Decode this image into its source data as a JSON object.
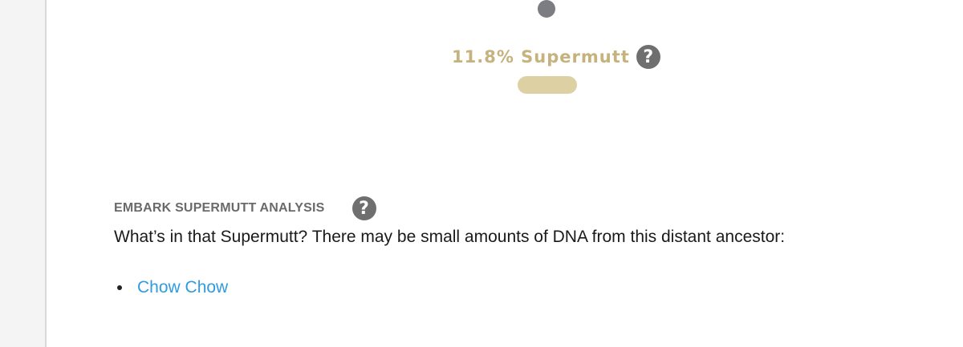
{
  "supermutt": {
    "label": "11.8% Supermutt",
    "help_icon": "question-circle-icon"
  },
  "analysis": {
    "title": "EMBARK SUPERMUTT ANALYSIS",
    "help_icon": "question-circle-icon",
    "description": "What’s in that Supermutt? There may be small amounts of DNA from this distant ancestor:",
    "ancestors": [
      "Chow Chow"
    ]
  },
  "colors": {
    "supermutt_gold": "#c5b27d",
    "pill": "#ddd1a3",
    "link_blue": "#2f9be0",
    "icon_gray": "#6f6f6f"
  }
}
